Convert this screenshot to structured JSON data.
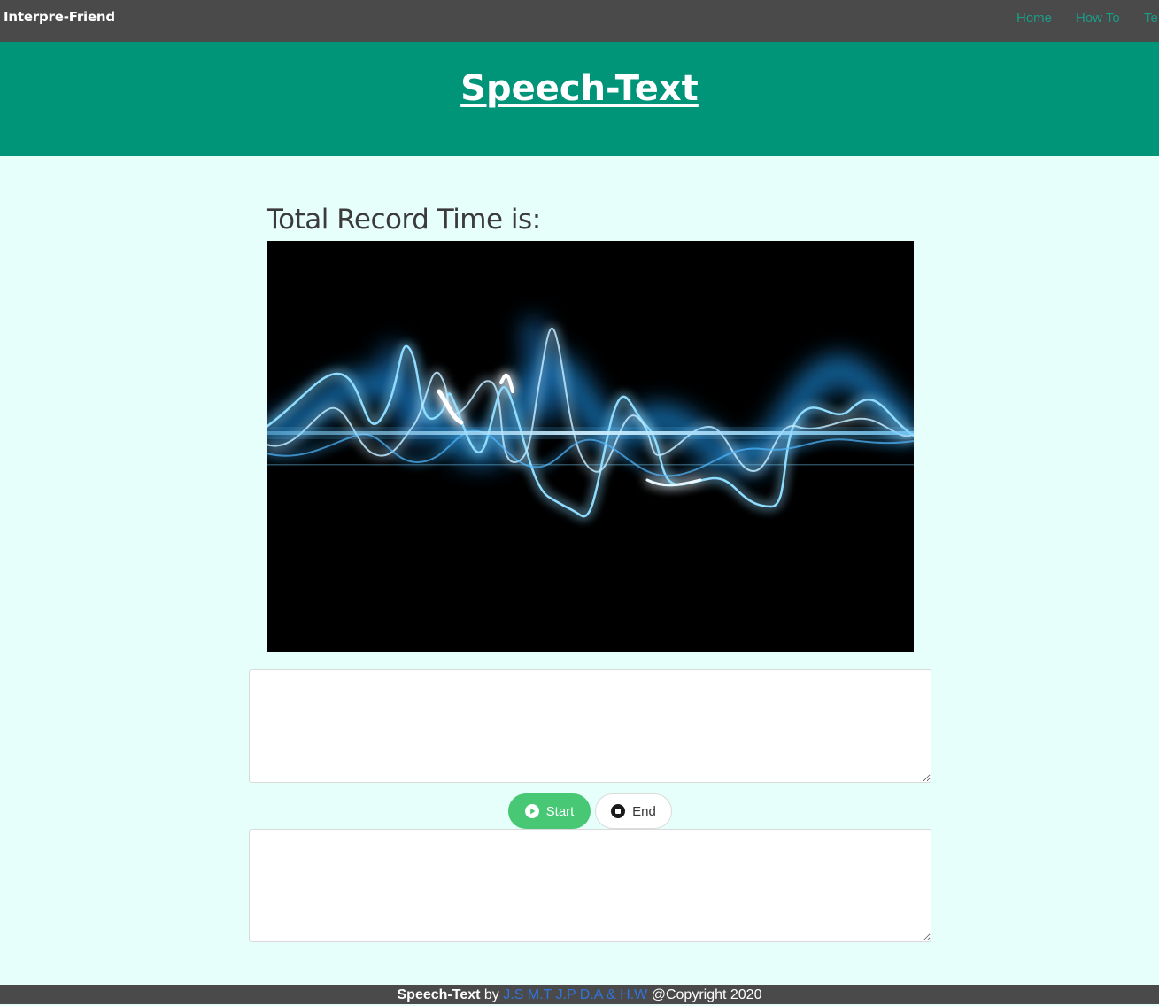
{
  "nav": {
    "brand": "Interpre-Friend",
    "links": [
      {
        "label": "Home"
      },
      {
        "label": "How To"
      },
      {
        "label": "Te"
      }
    ]
  },
  "hero": {
    "title": "Speech-Text"
  },
  "recorder": {
    "label": "Total Record Time is:",
    "time_value": "",
    "transcript_value": "",
    "translation_value": "",
    "start_label": "Start",
    "end_label": "End",
    "start_icon": "play-circle-icon",
    "end_icon": "stop-circle-icon"
  },
  "footer": {
    "app_name": "Speech-Text",
    "by": "by",
    "authors": "J.S M.T J.P D.A & H.W",
    "copyright": "@Copyright 2020"
  },
  "colors": {
    "navbar": "#4a4a4a",
    "hero": "#009479",
    "page_bg": "#e6fffb",
    "nav_link": "#1a9d88",
    "start_button": "#48c774",
    "footer_link": "#3273dc"
  }
}
